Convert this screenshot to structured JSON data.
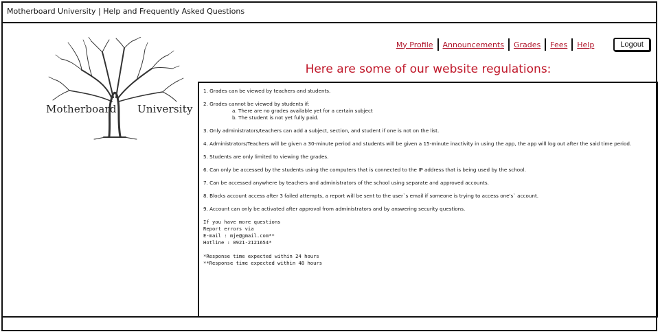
{
  "window": {
    "title": "Motherboard University | Help and Frequently Asked Questions"
  },
  "logo": {
    "word_left": "Motherboard",
    "word_right": "University",
    "icon": "tree-icon"
  },
  "nav": {
    "items": [
      {
        "label": "My Profile"
      },
      {
        "label": "Announcements"
      },
      {
        "label": "Grades"
      },
      {
        "label": "Fees"
      },
      {
        "label": "Help"
      }
    ],
    "logout_label": "Logout"
  },
  "page": {
    "heading": "Here are some of our website regulations:"
  },
  "rules": [
    "1. Grades can be viewed by teachers and students.",
    "2. Grades cannot be viewed by students if:",
    "3. Only administrators/teachers can add a subject, section, and student if one is not on the list.",
    "4. Administrators/Teachers will be given a 30-minute period and students will be given a 15-minute inactivity in using the app, the app will log out after the said time period.",
    "5. Students are only limited to viewing the grades.",
    "6. Can only be accessed by the students using the computers that is connected to the IP address that is being used by the school.",
    "7. Can be accessed anywhere by teachers and administrators of the school using separate and approved accounts.",
    "8. Blocks account access after 3 failed attempts, a report will be sent to the user`s email if someone is trying to access one's` account.",
    "9. Account can only be activated after approval from administrators and by answering security questions."
  ],
  "rule2_sub": [
    "a. There are no grades available yet for a certain subject",
    "b. The student is not yet fully paid."
  ],
  "contact": {
    "line1": "If you have more questions",
    "line2": "Report errors via",
    "email": "E-mail : mje@gmail.com**",
    "hotline": "Hotline : 0921-2121654*"
  },
  "notes": {
    "n1": "*Response time expected within 24 hours",
    "n2": "**Response time expected within 48 hours"
  },
  "colors": {
    "accent": "#c0182a",
    "link": "#b0152a",
    "border": "#111111"
  }
}
